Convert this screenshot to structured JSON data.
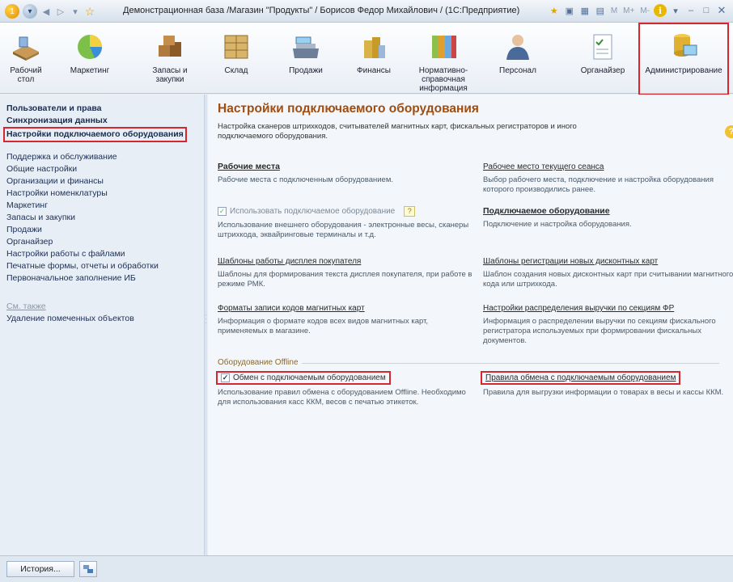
{
  "window": {
    "title": "Демонстрационная база /Магазин \"Продукты\" / Борисов Федор Михайлович / (1С:Предприятие)",
    "m_labels": [
      "M",
      "M+",
      "M-"
    ]
  },
  "ribbon": {
    "items": [
      {
        "label": "Рабочий стол",
        "icon": "desk-icon"
      },
      {
        "label": "Маркетинг",
        "icon": "pie-chart-icon"
      },
      {
        "label": "Запасы и закупки",
        "icon": "boxes-icon"
      },
      {
        "label": "Склад",
        "icon": "warehouse-icon"
      },
      {
        "label": "Продажи",
        "icon": "cash-register-icon"
      },
      {
        "label": "Финансы",
        "icon": "coins-icon"
      },
      {
        "label": "Нормативно-справочная информация",
        "icon": "binders-icon"
      },
      {
        "label": "Персонал",
        "icon": "person-icon"
      },
      {
        "label": "Органайзер",
        "icon": "checklist-icon"
      },
      {
        "label": "Администрирование",
        "icon": "admin-icon"
      }
    ],
    "active_index": 9
  },
  "nav": {
    "top_items": [
      "Пользователи и права",
      "Синхронизация данных",
      "Настройки подключаемого оборудования"
    ],
    "items": [
      "Поддержка и обслуживание",
      "Общие настройки",
      "Организации и финансы",
      "Настройки номенклатуры",
      "Маркетинг",
      "Запасы и закупки",
      "Продажи",
      "Органайзер",
      "Настройки работы с файлами",
      "Печатные формы, отчеты и обработки",
      "Первоначальное заполнение ИБ"
    ],
    "see_also_label": "См. также",
    "see_also_items": [
      "Удаление помеченных объектов"
    ]
  },
  "main": {
    "title": "Настройки подключаемого оборудования",
    "description": "Настройка сканеров штрихкодов, считывателей магнитных карт, фискальных регистраторов и иного подключаемого оборудования.",
    "help": "?",
    "blocks": {
      "workplaces": {
        "link": "Рабочие места",
        "text": "Рабочие места с подключенным оборудованием."
      },
      "current_workplace": {
        "link": "Рабочее место текущего сеанса",
        "text": "Выбор рабочего места, подключение и настройка оборудования которого производились ранее."
      },
      "use_equipment": {
        "label": "Использовать подключаемое оборудование",
        "checked": true,
        "help": "?",
        "text": "Использование внешнего оборудования - электронные весы, сканеры штрихкода, эквайринговые терминалы и т.д."
      },
      "connected_equipment": {
        "link": "Подключаемое оборудование",
        "text": "Подключение и настройка оборудования."
      },
      "display_templates": {
        "link": "Шаблоны работы дисплея покупателя",
        "text": "Шаблоны для формирования текста дисплея покупателя, при работе в режиме РМК."
      },
      "discount_templates": {
        "link": "Шаблоны регистрации новых дисконтных карт",
        "text": "Шаблон создания новых дисконтных карт при считывании магнитного кода или штрихкода."
      },
      "magnetic_formats": {
        "link": "Форматы записи кодов магнитных карт",
        "text": "Информация о формате кодов всех видов магнитных карт, применяемых в магазине."
      },
      "revenue_distribution": {
        "link": "Настройки распределения выручки по секциям ФР",
        "text": "Информация о распределении выручки по секциям фискального регистратора используемых при формировании фискальных документов."
      },
      "offline_group": "Оборудование Offline",
      "offline_exchange": {
        "label": "Обмен с подключаемым оборудованием",
        "checked": true,
        "text": "Использование правил обмена с оборудованием Offline. Необходимо для использования касс ККМ, весов с печатью этикеток."
      },
      "exchange_rules": {
        "link": "Правила обмена с подключаемым оборудованием",
        "text": "Правила для выгрузки информации о товарах в весы и кассы ККМ."
      }
    }
  },
  "statusbar": {
    "history_label": "История..."
  }
}
